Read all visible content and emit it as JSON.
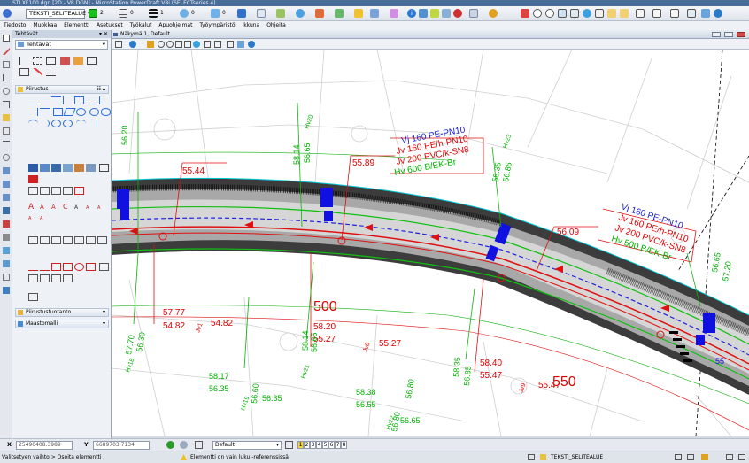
{
  "window": {
    "title": "STLXF100.dgn [2D - V8 DGN] - MicroStation PowerDraft V8i (SELECTseries 4)"
  },
  "toolbar": {
    "level": "TEKSTI_SELITEALUE",
    "color_value": "2",
    "style_value": "0",
    "weight_value": "1",
    "transparency_value": "0",
    "priority_value": "0"
  },
  "menu": {
    "items": [
      "Tiedosto",
      "Muokkaa",
      "Elementti",
      "Asetukset",
      "Työkalut",
      "Apuohjelmat",
      "Työympäristö",
      "Ikkuna",
      "Ohjeita"
    ]
  },
  "task_panel": {
    "header": "Tehtävät",
    "selected_task": "Tehtävät",
    "sections": {
      "piirustus": "Piirustus",
      "piirustustuotanto": "Piirustustuotanto",
      "maastomalli": "Maastomalli"
    }
  },
  "view": {
    "title": "Näkymä 1, Default"
  },
  "drawing": {
    "pipes_left": [
      "Vj 160 PE-PN10",
      "Jv 160 PE/h-PN10",
      "Jv 200 PVC/k-SN8",
      "Hv 600 B/EK-Br"
    ],
    "pipes_right": [
      "Vj 160 PE-PN10",
      "Jv 160 PE/h-PN10",
      "Jv 200 PVC/k-SN8",
      "Hv 500 B/EK-Br"
    ],
    "station_500": "500",
    "station_550": "550",
    "red_labels": {
      "a": "55.44",
      "b": "55.89",
      "c": "56.09",
      "d1": "57.77",
      "d2": "54.82",
      "d3": "54.82",
      "d_tag": "Jv1",
      "e1": "58.20",
      "e2": "55.27",
      "e3": "55.27",
      "e_tag": "Jv8",
      "f1": "58.40",
      "f2": "55.47",
      "f3": "55.47",
      "f_tag": "Jv9"
    },
    "green_labels": {
      "g1": "56.20",
      "g2": "58.14",
      "g3": "56.65",
      "g4": "Hv20",
      "g5": "58.35",
      "g6": "56.85",
      "g7": "Hv23",
      "g8": "57.70",
      "g9": "56.30",
      "g10": "Hv18",
      "g11": "58.14",
      "g12": "56.65",
      "g13": "Hv21",
      "g14": "58.17",
      "g15": "56.35",
      "g16": "56.60",
      "g17": "56.35",
      "g18": "Hv19",
      "g19": "58.38",
      "g20": "56.55",
      "g21": "56.65",
      "g22": "Hv22",
      "g23": "56.80",
      "g24": "56.80",
      "g25": "58.35",
      "g26": "56.85",
      "g27": "56.65",
      "g28": "57.20",
      "g29": "55"
    }
  },
  "status": {
    "x_label": "X",
    "x_value": "25490408.3989",
    "y_label": "Y",
    "y_value": "6689703.7134",
    "view_combo": "Default",
    "view_numbers": [
      "1",
      "2",
      "3",
      "4",
      "5",
      "6",
      "7",
      "8"
    ],
    "prompt_left": "Valitsetyen vaihto > Osoita elementti",
    "message": "Elementti on vain luku -referenssissä",
    "level_display": "TEKSTI_SELITEALUE"
  },
  "colors": {
    "road_dark": "#404040",
    "road_light": "#d0d0d0",
    "text_red": "#e00000",
    "text_green": "#00b000",
    "text_blue": "#1a22d0",
    "pipe_blue": "#1010e0"
  }
}
